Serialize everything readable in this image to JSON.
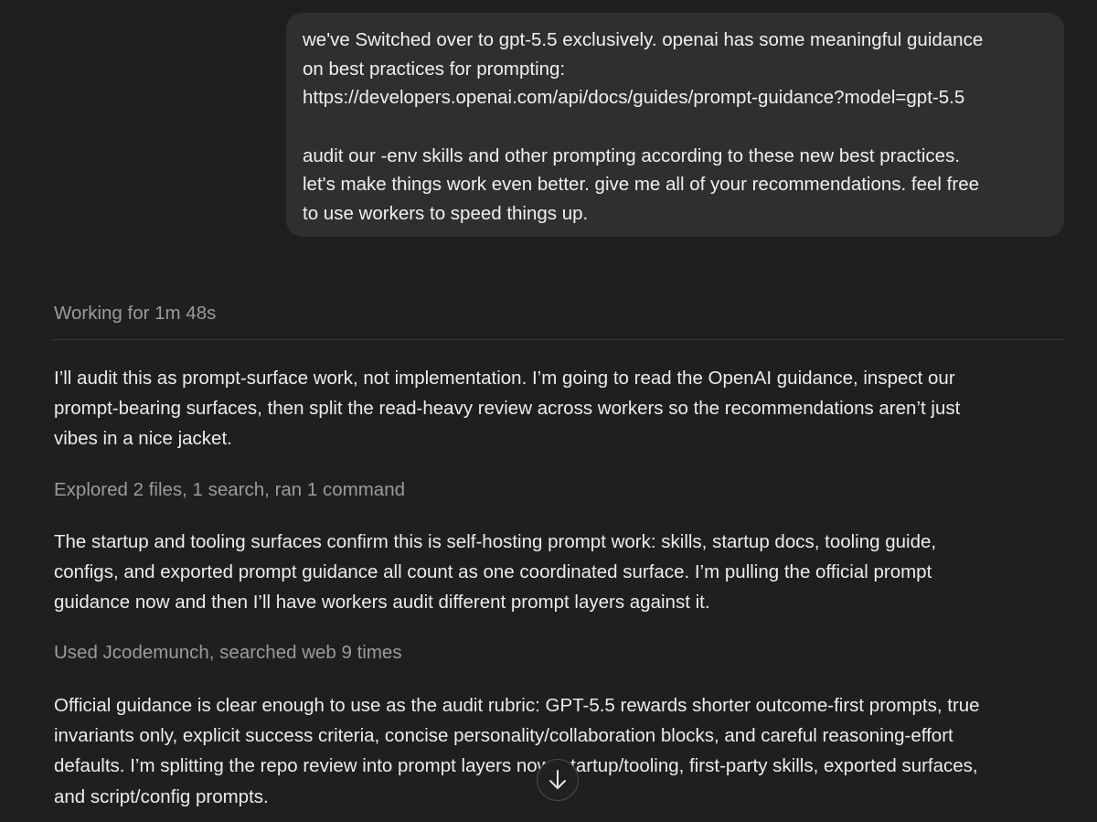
{
  "user_message": {
    "lines": [
      "we've Switched over to gpt-5.5 exclusively. openai has some meaningful guidance",
      "on best practices for prompting:",
      "https://developers.openai.com/api/docs/guides/prompt-guidance?model=gpt-5.5",
      "",
      "audit our -env skills and other prompting according to these new best practices.",
      "let's make things work even better. give me all of your recommendations. feel free",
      "to use workers to speed things up."
    ]
  },
  "working_status": "Working for 1m 48s",
  "assistant": {
    "para1": [
      "I’ll audit this as prompt-surface work, not implementation. I’m going to read the OpenAI guidance, inspect our",
      "prompt-bearing surfaces, then split the read-heavy review across workers so the recommendations aren’t just",
      "vibes in a nice jacket."
    ],
    "activity1": "Explored 2 files, 1 search, ran 1 command",
    "para2": [
      "The startup and tooling surfaces confirm this is self-hosting prompt work: skills, startup docs, tooling guide,",
      "configs, and exported prompt guidance all count as one coordinated surface. I’m pulling the official prompt",
      "guidance now and then I’ll have workers audit different prompt layers against it."
    ],
    "activity2": "Used Jcodemunch, searched web 9 times",
    "para3": [
      "Official guidance is clear enough to use as the audit rubric: GPT-5.5 rewards shorter outcome-first prompts, true",
      "invariants only, explicit success criteria, concise personality/collaboration blocks, and careful reasoning-effort",
      "defaults. I’m splitting the repo review into prompt layers now: startup/tooling, first-party skills, exported surfaces,",
      "and script/config prompts."
    ]
  },
  "scroll_button": {
    "icon": "arrow-down-icon"
  },
  "colors": {
    "background": "#1f1f1f",
    "bubble": "#2f2f2f",
    "text": "#ececec",
    "muted": "#9b9b9b"
  }
}
